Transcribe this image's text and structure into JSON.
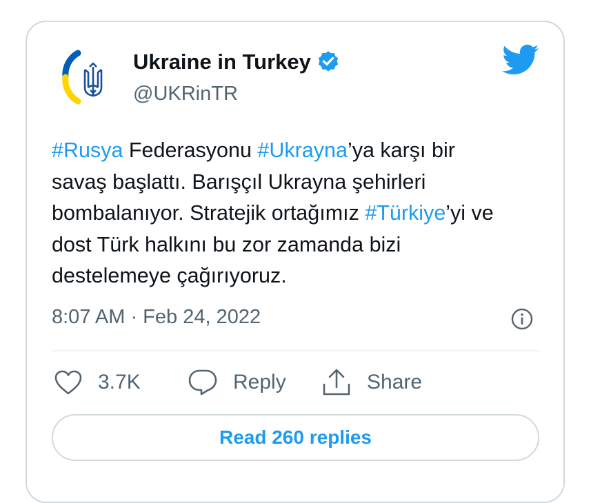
{
  "author": {
    "display_name": "Ukraine in Turkey",
    "handle": "@UKRinTR",
    "verified": true,
    "avatar_icon": "ukraine-trident-icon"
  },
  "brand": {
    "icon": "twitter-bird-icon",
    "color": "#1d9bf0"
  },
  "tweet": {
    "lines": [
      [
        {
          "text": "#Rusya",
          "hashtag": true
        },
        {
          "text": " Federasyonu ",
          "hashtag": false
        },
        {
          "text": "#Ukrayna",
          "hashtag": true
        },
        {
          "text": "’ya karşı bir",
          "hashtag": false
        }
      ],
      [
        {
          "text": "savaş başlattı. Barışçıl Ukrayna şehirleri",
          "hashtag": false
        }
      ],
      [
        {
          "text": "bombalanıyor. Stratejik ortağımız ",
          "hashtag": false
        },
        {
          "text": "#Türkiye",
          "hashtag": true
        },
        {
          "text": "’yi ve",
          "hashtag": false
        }
      ],
      [
        {
          "text": "dost Türk halkını bu zor zamanda bizi",
          "hashtag": false
        }
      ],
      [
        {
          "text": "destelemeye çağırıyoruz.",
          "hashtag": false
        }
      ]
    ],
    "timestamp": "8:07 AM · Feb 24, 2022"
  },
  "actions": {
    "like_count": "3.7K",
    "reply_label": "Reply",
    "share_label": "Share"
  },
  "read_replies_label": "Read 260 replies",
  "colors": {
    "text": "#0f1419",
    "secondary": "#536471",
    "accent": "#1d9bf0",
    "border": "#cfd9de",
    "flag_blue": "#005bbb",
    "flag_yellow": "#ffd500"
  }
}
